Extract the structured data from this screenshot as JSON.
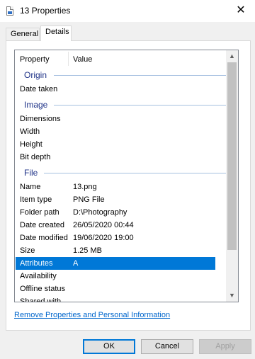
{
  "window": {
    "title": "13 Properties",
    "close_glyph": "✕"
  },
  "tabs": [
    {
      "label": "General"
    },
    {
      "label": "Details"
    }
  ],
  "table": {
    "headers": {
      "property": "Property",
      "value": "Value"
    },
    "groups": {
      "origin": "Origin",
      "image": "Image",
      "file": "File"
    },
    "origin_rows": [
      {
        "property": "Date taken",
        "value": ""
      }
    ],
    "image_rows": [
      {
        "property": "Dimensions",
        "value": ""
      },
      {
        "property": "Width",
        "value": ""
      },
      {
        "property": "Height",
        "value": ""
      },
      {
        "property": "Bit depth",
        "value": ""
      }
    ],
    "file_rows": [
      {
        "property": "Name",
        "value": "13.png"
      },
      {
        "property": "Item type",
        "value": "PNG File"
      },
      {
        "property": "Folder path",
        "value": "D:\\Photography"
      },
      {
        "property": "Date created",
        "value": "26/05/2020 00:44"
      },
      {
        "property": "Date modified",
        "value": "19/06/2020 19:00"
      },
      {
        "property": "Size",
        "value": "1.25 MB"
      },
      {
        "property": "Attributes",
        "value": "A"
      },
      {
        "property": "Availability",
        "value": ""
      },
      {
        "property": "Offline status",
        "value": ""
      },
      {
        "property": "Shared with",
        "value": ""
      }
    ],
    "selected_row": "Attributes"
  },
  "link": {
    "label": "Remove Properties and Personal Information"
  },
  "buttons": {
    "ok": "OK",
    "cancel": "Cancel",
    "apply": "Apply"
  },
  "colors": {
    "accent": "#0078d7",
    "group_header": "#1e3287",
    "link": "#0066cc"
  }
}
